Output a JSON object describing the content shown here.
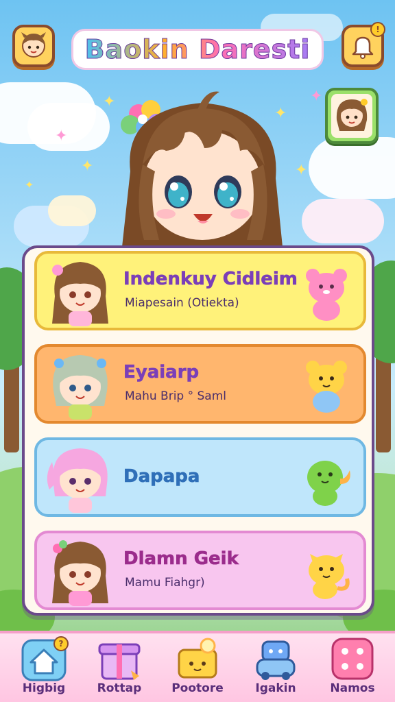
{
  "header": {
    "title": "Baokin Daresti",
    "left_icon": "profile-icon",
    "right_icon": "notification-bell-icon",
    "right_badge": "!"
  },
  "hero": {
    "character": "main-character"
  },
  "profile_frame": {
    "icon": "player-avatar-icon"
  },
  "cards": [
    {
      "name": "Indenkuy Cidleim",
      "subtitle": "Miapesain (Otiekta)",
      "bg": "#fff27a",
      "border": "#e8b93a",
      "name_color": "#7b3fb8",
      "hair": "#8a5a33",
      "pet": "pink-bear-pet-icon",
      "pet_color": "#ff8fc4"
    },
    {
      "name": "Eyaiarp",
      "subtitle": "Mahu Brip ° Saml",
      "bg": "#ffb66e",
      "border": "#e3892f",
      "name_color": "#7b3fb8",
      "hair": "#b7c9b1",
      "pet": "yellow-bear-pet-icon",
      "pet_color": "#ffd447"
    },
    {
      "name": "Dapapa",
      "subtitle": "",
      "bg": "#bfe6fb",
      "border": "#6fb8e3",
      "name_color": "#2f6fb8",
      "hair": "#f6a7e0",
      "pet": "green-dino-pet-icon",
      "pet_color": "#7fd24a"
    },
    {
      "name": "Dlamn Geik",
      "subtitle": "Mamu Fiahgr)",
      "bg": "#f8c6ef",
      "border": "#e38ad2",
      "name_color": "#9b2c8c",
      "hair": "#8a5a33",
      "pet": "yellow-cat-pet-icon",
      "pet_color": "#ffd447"
    }
  ],
  "nav": [
    {
      "label": "Higbig",
      "icon": "home-icon",
      "badge": "?"
    },
    {
      "label": "Rottap",
      "icon": "gift-box-icon",
      "badge": ""
    },
    {
      "label": "Pootore",
      "icon": "treasure-icon",
      "badge": ""
    },
    {
      "label": "Igakin",
      "icon": "robot-toy-icon",
      "badge": ""
    },
    {
      "label": "Namos",
      "icon": "dice-icon",
      "badge": ""
    }
  ]
}
